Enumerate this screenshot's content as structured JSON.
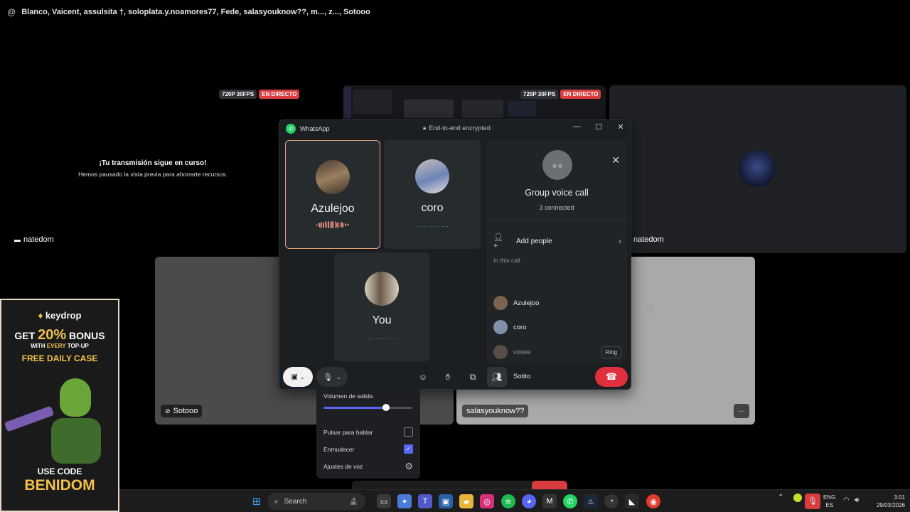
{
  "topbar": {
    "at_symbol": "@",
    "participants": "Blanco, Vaicent, assulsita †, soloplata.y.noamores77, Fede, salasyouknow??, m..., z..., Sotooo"
  },
  "stream1": {
    "resolution": "720P 30FPS",
    "live": "EN DIRECTO",
    "paused_title": "¡Tu transmisión sigue en curso!",
    "paused_text": "Hemos pausado la vista previa para ahorrarte recursos.",
    "user": "natedom"
  },
  "stream2": {
    "resolution": "720P 30FPS",
    "live": "EN DIRECTO"
  },
  "stream3": {
    "user": "natedom"
  },
  "tile_sotooo": {
    "user": "Sotooo"
  },
  "tile_salas": {
    "user": "salasyouknow??",
    "more": "···"
  },
  "whatsapp": {
    "app_name": "WhatsApp",
    "encryption": "End-to-end encrypted",
    "window_controls": [
      "—",
      "☐",
      "✕"
    ],
    "participants": [
      {
        "name": "Azulejoo",
        "speaking": true,
        "avatar_color": "#7a6350"
      },
      {
        "name": "coro",
        "speaking": false,
        "avatar_color": "#8090a8"
      },
      {
        "name": "You",
        "speaking": false,
        "avatar_color": "#8a7a66"
      }
    ],
    "panel": {
      "title": "Group voice call",
      "subtitle": "3 connected",
      "add_people": "Add people",
      "in_call_label": "In this call",
      "members": [
        {
          "name": "Azulejoo",
          "dim": false,
          "avatar_color": "#7a6350"
        },
        {
          "name": "coro",
          "dim": false,
          "avatar_color": "#8090a8"
        },
        {
          "name": "violee",
          "dim": true,
          "ring": "Ring",
          "avatar_color": "#5a4d48"
        },
        {
          "name": "Sotito",
          "dim": false,
          "avatar_color": "#15181a"
        }
      ]
    },
    "controls": {
      "camera": "camera-off-icon",
      "mic": "mic-icon",
      "emoji": "emoji-icon",
      "raise_hand": "hand-icon",
      "share": "screen-share-icon",
      "people": "people-icon",
      "end": "end-call-icon"
    }
  },
  "audio_popup": {
    "output_volume": "Volumen de salida",
    "output_level": 0.7,
    "push_to_talk": "Pulsar para hablar",
    "push_to_talk_checked": false,
    "deafen": "Enmudecer",
    "deafen_checked": true,
    "voice_settings": "Ajustes de voz"
  },
  "ad": {
    "brand_prefix": "♦ ",
    "brand": "keydrop",
    "line1_get": "GET ",
    "line1_pct": "20%",
    "line1_bonus": " BONUS",
    "line2_a": "WITH ",
    "line2_b": "EVERY",
    "line2_c": " TOP-UP",
    "line3": "FREE DAILY CASE",
    "use_code": "USE CODE",
    "code": "BENIDOM"
  },
  "taskbar": {
    "search": "Search",
    "lang_1": "ENG",
    "lang_2": "ES",
    "time": "3:01",
    "date": "29/03/2026"
  },
  "colors": {
    "accent_whatsapp": "#25d366",
    "end_call": "#e0303e",
    "discord_blurple": "#5865f2",
    "live": "#d83c3e"
  }
}
